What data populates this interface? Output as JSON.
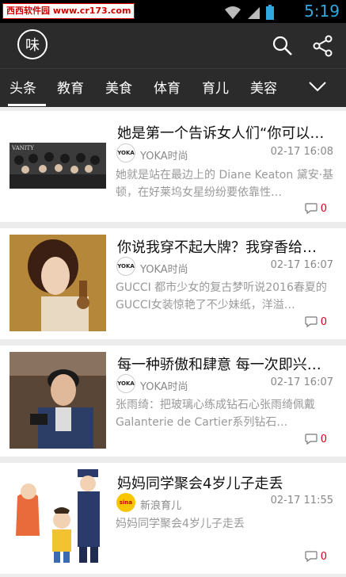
{
  "status_bar": {
    "watermark_site": "西西软件园",
    "watermark_url": "www.cr173.com",
    "time": "5:19",
    "accent": "#2fa8e0"
  },
  "app": {
    "logo_text": "味",
    "search_icon": "search-icon",
    "share_icon": "share-icon"
  },
  "tabs": [
    {
      "label": "头条"
    },
    {
      "label": "教育"
    },
    {
      "label": "美食"
    },
    {
      "label": "体育"
    },
    {
      "label": "育儿"
    },
    {
      "label": "美容"
    }
  ],
  "articles": [
    {
      "title": "她是第一个告诉女人们“你可以…",
      "source_logo": "YOKA",
      "source": "YOKA时尚",
      "time": "02-17 16:08",
      "summary": "她就是站在最边上的 Diane Keaton 黛安·基顿，在好莱坞女星纷纷要依靠性…",
      "comments": "0"
    },
    {
      "title": "你说我穿不起大牌？我穿香给…",
      "source_logo": "YOKA",
      "source": "YOKA时尚",
      "time": "02-17 16:07",
      "summary": "GUCCI 都市少女的复古梦听说2016春夏的GUCCI女装惊艳了不少妹纸，洋溢…",
      "comments": "0"
    },
    {
      "title": "每一种骄傲和肆意 每一次即兴…",
      "source_logo": "YOKA",
      "source": "YOKA时尚",
      "time": "02-17 16:07",
      "summary": "张雨绮：把玻璃心练成钻石心张雨绮佩戴Galanterie de Cartier系列钻石…",
      "comments": "0"
    },
    {
      "title": "妈妈同学聚会4岁儿子走丢",
      "source_logo": "sina",
      "source": "新浪育儿",
      "time": "02-17 11:55",
      "summary": "妈妈同学聚会4岁儿子走丢",
      "comments": "0"
    }
  ]
}
